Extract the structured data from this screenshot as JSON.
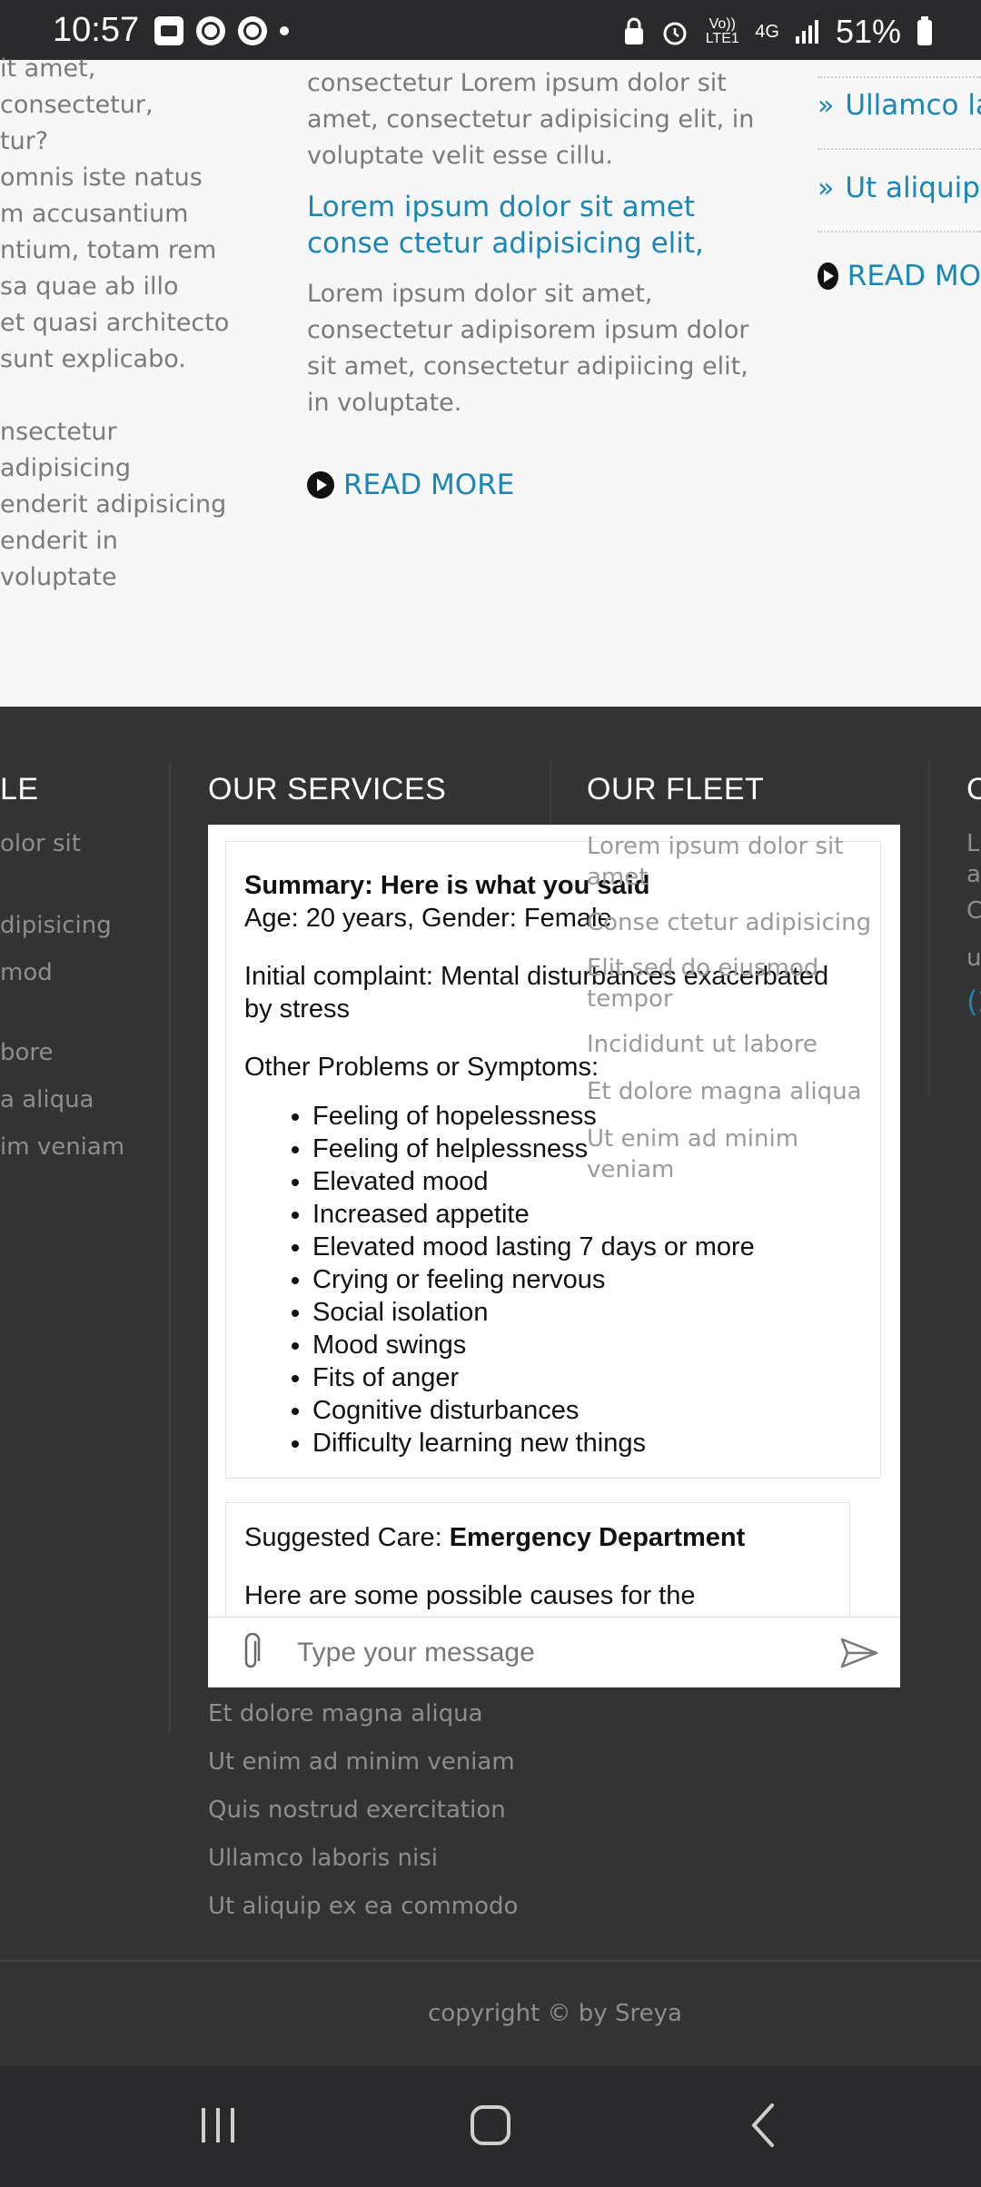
{
  "status_bar": {
    "time": "10:57",
    "network_top": "Vo)) LTE1",
    "network_4g": "4G",
    "battery": "51%"
  },
  "content": {
    "col1_lines": [
      "it amet, consectetur,",
      "tur?",
      "",
      "omnis iste natus",
      "m accusantium",
      "ntium, totam rem",
      "sa quae ab illo",
      "et quasi architecto",
      "sunt explicabo.",
      "",
      "nsectetur adipisicing",
      "enderit adipisicing",
      "enderit in voluptate"
    ],
    "col2_intro": "consectetur Lorem ipsum dolor sit amet, consectetur adipisicing elit, in voluptate velit esse cillu.",
    "col2_title": "Lorem ipsum dolor sit amet conse ctetur adipisicing elit,",
    "col2_body": "Lorem ipsum dolor sit amet, consectetur adipisorem ipsum dolor sit amet, consectetur adipiicing elit, in voluptate.",
    "read_more": "READ MORE",
    "col3_links": [
      "Ullamco la",
      "Ut aliquip"
    ],
    "col3_read_more": "READ MO"
  },
  "footer": {
    "col1_head": "LE",
    "col1_items": [
      "olor sit",
      "",
      "dipisicing",
      "mod",
      "",
      "bore",
      "a aliqua",
      "im veniam"
    ],
    "services_head": "OUR SERVICES",
    "services_items": [
      "Et dolore magna aliqua",
      "Ut enim ad minim veniam",
      "Quis nostrud exercitation",
      "Ullamco laboris nisi",
      "Ut aliquip ex ea commodo"
    ],
    "fleet_head": "OUR FLEET",
    "fleet_items": [
      "Lorem ipsum dolor sit amet",
      "Conse ctetur adipisicing",
      "Elit sed do eiusmod tempor",
      "Incididunt ut labore",
      "Et dolore magna aliqua",
      "Ut enim ad minim veniam"
    ],
    "col4_head": "C",
    "col4_items": [
      "L",
      "a",
      "C",
      "u",
      "(2"
    ],
    "copyright": "copyright © by Sreya"
  },
  "chat": {
    "summary_title": "Summary: Here is what you said",
    "age_gender": "Age: 20 years, Gender: Female",
    "initial_complaint": "Initial complaint: Mental disturbances exacerbated by stress",
    "other_problems_label": "Other Problems or Symptoms:",
    "symptoms": [
      "Feeling of hopelessness",
      "Feeling of helplessness",
      "Elevated mood",
      "Increased appetite",
      "Elevated mood lasting 7 days or more",
      "Crying or feeling nervous",
      "Social isolation",
      "Mood swings",
      "Fits of anger",
      "Cognitive disturbances",
      "Difficulty learning new things"
    ],
    "suggested_care_label": "Suggested Care: ",
    "suggested_care_value": "Emergency Department",
    "causes_intro": "Here are some possible causes for the",
    "input_placeholder": "Type your message"
  }
}
